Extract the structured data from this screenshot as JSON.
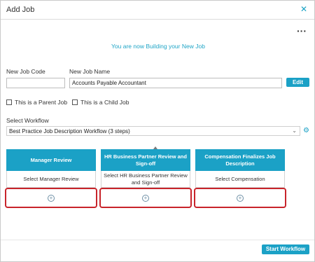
{
  "dialog": {
    "title": "Add Job",
    "close_icon": "close-icon",
    "more_icon": "more-options-icon"
  },
  "subtitle": "You are now Building your New Job",
  "form": {
    "job_code_label": "New Job Code",
    "job_code_value": "",
    "job_name_label": "New Job Name",
    "job_name_value": "Accounts Payable Accountant",
    "edit_label": "Edit",
    "parent_job_label": "This is a Parent Job",
    "child_job_label": "This is a Child Job",
    "workflow_label": "Select Workflow",
    "workflow_value": "Best Practice Job Description Workflow (3 steps)"
  },
  "steps": [
    {
      "title": "Manager Review",
      "select_text": "Select Manager Review"
    },
    {
      "title": "HR Business Partner Review and Sign-off",
      "select_text": "Select HR Business Partner Review and Sign-off"
    },
    {
      "title": "Compensation Finalizes Job Description",
      "select_text": "Select Compensation"
    }
  ],
  "start_workflow_label": "Start Workflow",
  "colors": {
    "accent": "#1ba1c6",
    "highlight_border": "#c8242b"
  }
}
